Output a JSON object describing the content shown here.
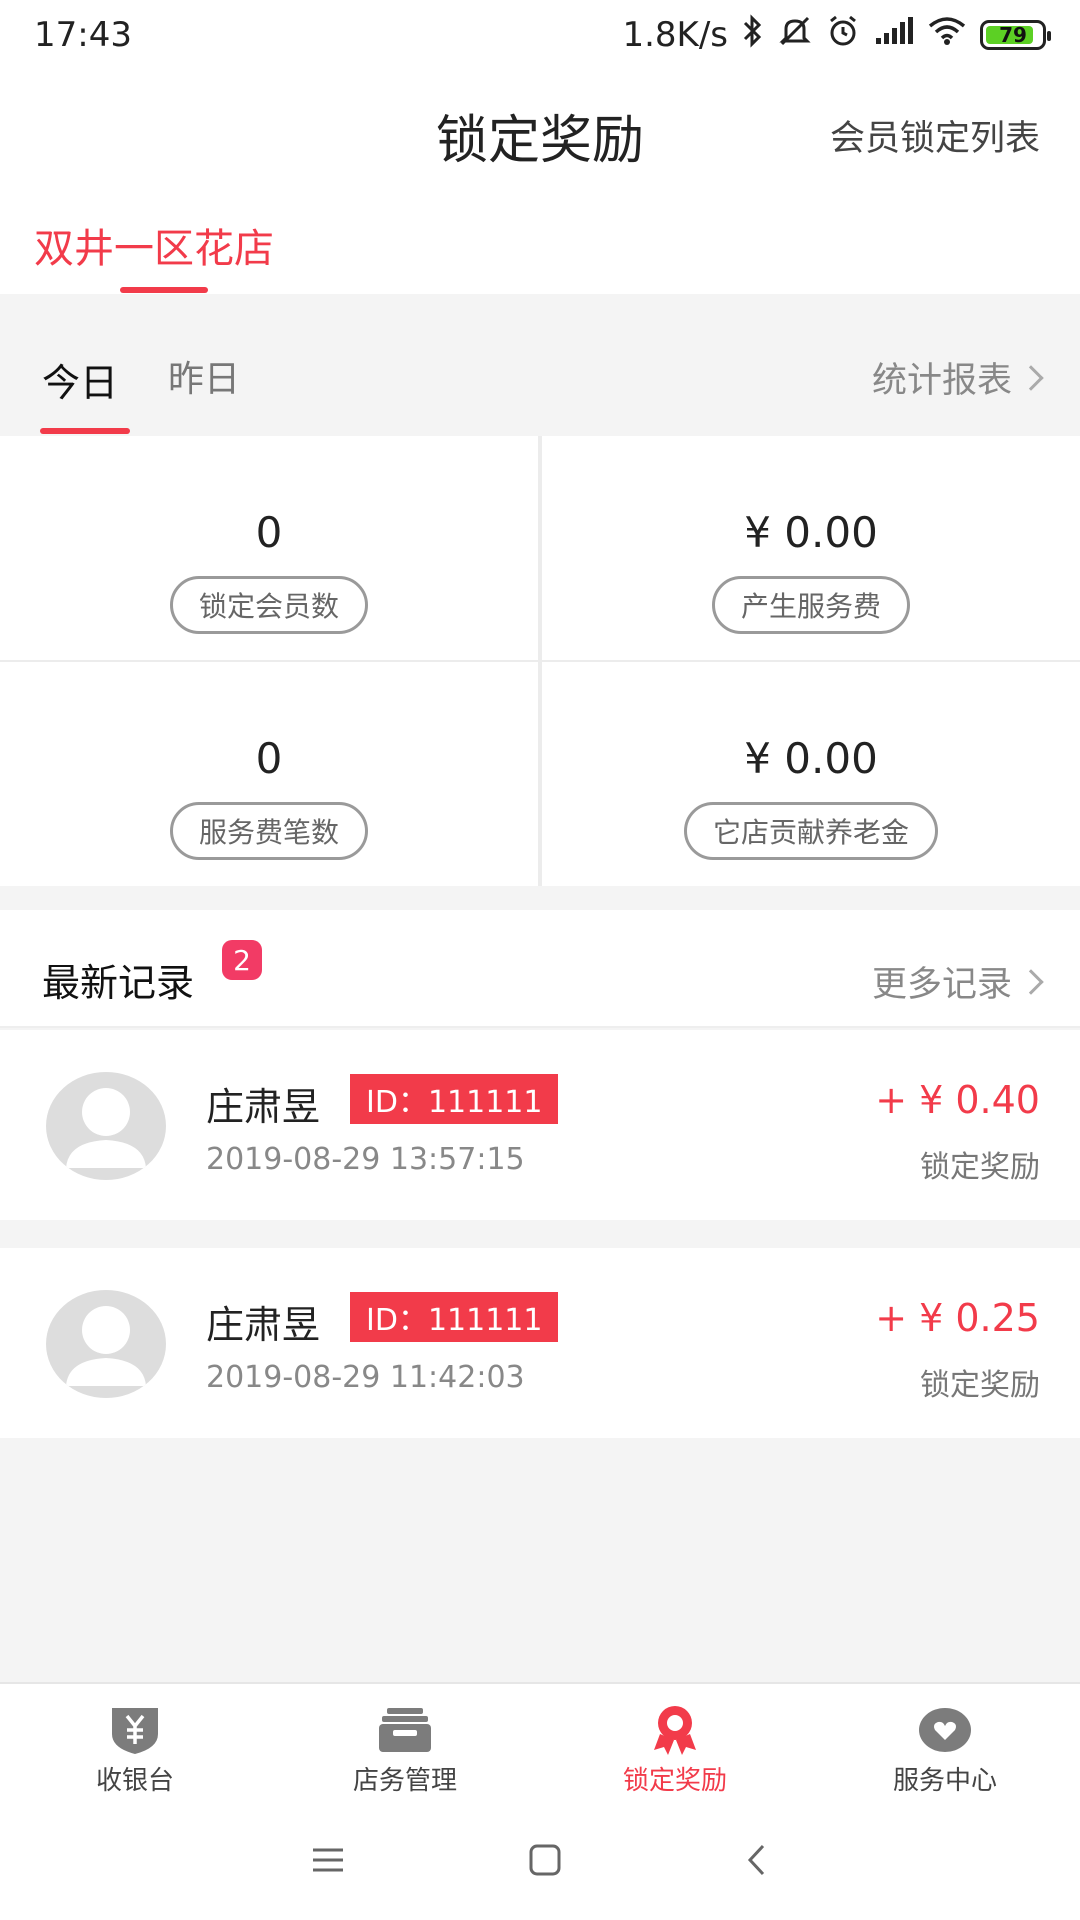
{
  "status": {
    "time": "17:43",
    "speed": "1.8K/s",
    "battery": "79",
    "icons": [
      "bluetooth-icon",
      "mute-icon",
      "alarm-icon",
      "signal-icon",
      "wifi-icon",
      "battery-icon"
    ]
  },
  "header": {
    "title": "锁定奖励",
    "right_link": "会员锁定列表"
  },
  "store": {
    "name": "双井一区花店"
  },
  "day_tabs": {
    "today": "今日",
    "yesterday": "昨日",
    "report": "统计报表"
  },
  "stats": [
    {
      "value": "0",
      "label": "锁定会员数"
    },
    {
      "value": "¥ 0.00",
      "label": "产生服务费"
    },
    {
      "value": "0",
      "label": "服务费笔数"
    },
    {
      "value": "¥ 0.00",
      "label": "它店贡献养老金"
    }
  ],
  "records": {
    "title": "最新记录",
    "badge": "2",
    "more": "更多记录",
    "items": [
      {
        "name": "庄肃昱",
        "id": "ID：111111",
        "time": "2019-08-29 13:57:15",
        "amount": "+ ¥ 0.40",
        "kind": "锁定奖励"
      },
      {
        "name": "庄肃昱",
        "id": "ID：111111",
        "time": "2019-08-29 11:42:03",
        "amount": "+ ¥ 0.25",
        "kind": "锁定奖励"
      }
    ]
  },
  "tabbar": {
    "items": [
      {
        "label": "收银台",
        "icon": "cashier-shield-icon"
      },
      {
        "label": "店务管理",
        "icon": "store-box-icon"
      },
      {
        "label": "锁定奖励",
        "icon": "award-ribbon-icon",
        "active": true
      },
      {
        "label": "服务中心",
        "icon": "heart-bubble-icon"
      }
    ]
  },
  "colors": {
    "accent": "#f23b4a",
    "badge": "#f23b65",
    "background": "#f4f4f4"
  }
}
